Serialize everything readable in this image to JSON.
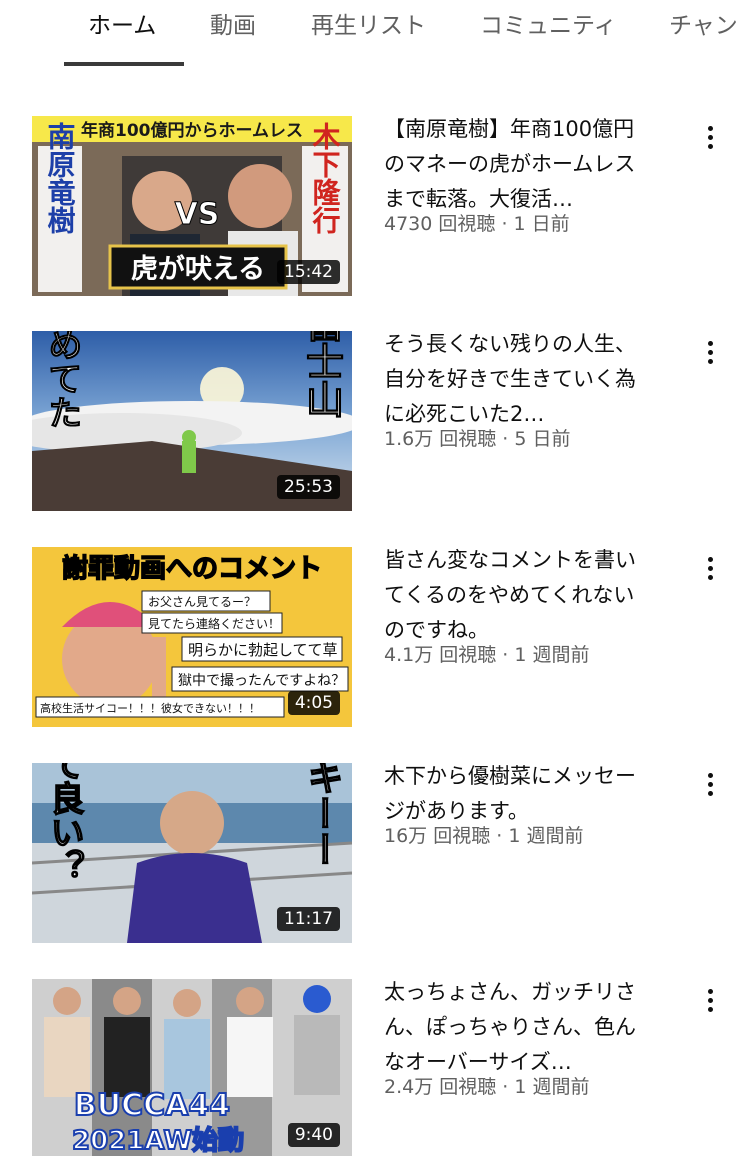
{
  "tabs": [
    {
      "label": "ホーム",
      "active": true
    },
    {
      "label": "動画",
      "active": false
    },
    {
      "label": "再生リスト",
      "active": false
    },
    {
      "label": "コミュニティ",
      "active": false
    },
    {
      "label": "チャン",
      "active": false
    }
  ],
  "videos": [
    {
      "title": "【南原竜樹】年商100億円のマネーの虎がホームレスまで転落。大復活…",
      "views": "4730 回視聴",
      "age": "1 日前",
      "duration": "15:42",
      "thumb_text": {
        "banner": "年商100億円からホームレス",
        "left": "南原竜樹",
        "right": "木下隆行",
        "vs": "VS",
        "bottom": "虎が吠える"
      }
    },
    {
      "title": "そう長くない残りの人生、自分を好きで生きていく為に必死こいた2…",
      "views": "1.6万 回視聴",
      "age": "5 日前",
      "duration": "25:53",
      "thumb_text": {
        "left": "なめてた",
        "right": "富士山"
      }
    },
    {
      "title": "皆さん変なコメントを書いてくるのをやめてくれないのですね。",
      "views": "4.1万 回視聴",
      "age": "1 週間前",
      "duration": "4:05",
      "thumb_text": {
        "banner": "謝罪動画へのコメント",
        "c1": "お父さん見てるー？",
        "c2": "見てたら連絡ください！",
        "c3": "明らかに勃起してて草",
        "c4": "獄中で撮ったんですよね？",
        "c5": "高校生活サイコー！！！彼女できない！！！"
      }
    },
    {
      "title": "木下から優樹菜にメッセージがあります。",
      "views": "16万 回視聴",
      "age": "1 週間前",
      "duration": "11:17",
      "thumb_text": {
        "left": "言って良い？",
        "right": "ユッキーー"
      }
    },
    {
      "title": "太っちょさん、ガッチリさん、ぽっちゃりさん、色んなオーバーサイズ…",
      "views": "2.4万 回視聴",
      "age": "1 週間前",
      "duration": "9:40",
      "thumb_text": {
        "line1": "BUCCA44",
        "line2": "2021AW始動"
      }
    }
  ],
  "meta_separator": " · "
}
